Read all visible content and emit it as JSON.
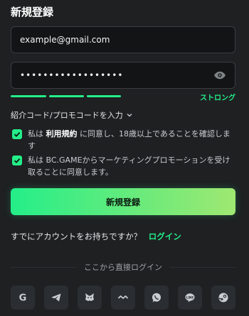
{
  "form": {
    "title": "新規登録",
    "email_value": "example@gmail.com",
    "password_value": "••••••••••••••••••",
    "password_strength_label": "ストロング",
    "password_strength_level": 1.0,
    "promo_label": "紹介コード/プロモコードを入力",
    "terms": {
      "before": "私は",
      "link": "利用規約",
      "after": "に同意し、18歳以上であることを確認します",
      "checked": true
    },
    "marketing": {
      "text": "私は BC.GAMEからマーケティングプロモーションを受け取ることに同意します。",
      "checked": true
    },
    "register_button": "新規登録",
    "have_account_text": "すでにアカウントをお持ちですか？",
    "login_link": "ログイン"
  },
  "social": {
    "divider_text": "ここから直接ログイン",
    "providers": [
      "google-icon",
      "telegram-icon",
      "metamask-icon",
      "web3-icon",
      "whatsapp-icon",
      "line-icon",
      "steam-icon"
    ]
  },
  "colors": {
    "accent": "#24ee89",
    "background": "#1e2022",
    "field_bg": "#121415"
  }
}
